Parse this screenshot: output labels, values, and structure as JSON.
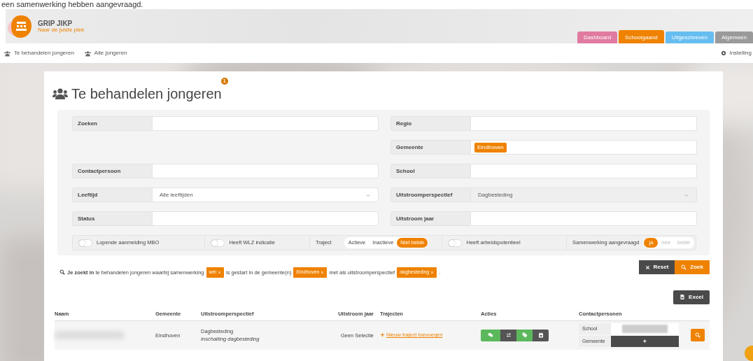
{
  "caption": "een samenwerking hebben aangevraagd.",
  "header": {
    "app_title": "GRIP JIKP",
    "tagline": "Naar de juiste plek",
    "tabs": [
      {
        "label": "Dashboard",
        "color": "#e07aa0",
        "selected": false
      },
      {
        "label": "Schoolgaand",
        "color": "#ef8200",
        "selected": true
      },
      {
        "label": "Uitgeschreven",
        "color": "#66bdf0",
        "selected": false
      },
      {
        "label": "Algemeen",
        "color": "#9a9a9a",
        "selected": false
      }
    ]
  },
  "nav": {
    "items": [
      {
        "label": "Te behandelen jongeren"
      },
      {
        "label": "Alle jongeren"
      }
    ],
    "settings": "Instelling"
  },
  "page": {
    "title": "Te behandelen jongeren",
    "badge": "1"
  },
  "filters": {
    "rows": [
      {
        "left": {
          "label": "Zoeken",
          "kind": "input"
        },
        "right": {
          "label": "Regio",
          "kind": "input"
        }
      },
      {
        "left": null,
        "right": {
          "label": "Gemeente",
          "kind": "tags",
          "tags": [
            "Eindhoven"
          ]
        }
      },
      {
        "left": {
          "label": "Contactpersoon",
          "kind": "input"
        },
        "right": {
          "label": "School",
          "kind": "input"
        }
      },
      {
        "left": {
          "label": "Leeftijd",
          "kind": "select",
          "value": "Alle leeftijden",
          "disabled": false
        },
        "right": {
          "label": "Uitstroomperspectief",
          "kind": "select",
          "value": "Dagbesteding",
          "disabled": true
        }
      },
      {
        "left": {
          "label": "Status",
          "kind": "input"
        },
        "right": {
          "label": "Uitstroom jaar",
          "kind": "input"
        }
      }
    ],
    "toggles": [
      {
        "kind": "switch",
        "label": "Lopende aanmelding MBO",
        "on": false
      },
      {
        "kind": "switch",
        "label": "Heeft WLZ indicatie",
        "on": false
      },
      {
        "kind": "segmented",
        "label": "Traject",
        "options": [
          {
            "label": "Actieve",
            "selected": false
          },
          {
            "label": "Inactieve",
            "selected": false
          },
          {
            "label": "Niet beide",
            "selected": true
          }
        ]
      },
      {
        "kind": "switch",
        "label": "Heeft arbeidspotentieel",
        "on": false
      },
      {
        "kind": "segmented",
        "label": "Samenwerking aangevraagd",
        "options": [
          {
            "label": "ja",
            "selected": true
          },
          {
            "label": "nee",
            "selected": false
          },
          {
            "label": "beide",
            "selected": false
          }
        ]
      }
    ]
  },
  "summary": [
    {
      "kind": "text",
      "text": "**Je zoekt in** te behandelen jongeren waarbij samenwerking"
    },
    {
      "kind": "chip",
      "text": "wel"
    },
    {
      "kind": "text",
      "text": "is gestart in de gemeente(n)"
    },
    {
      "kind": "chip",
      "text": "Eindhoven"
    },
    {
      "kind": "text",
      "text": "met als uitstroomperspectief"
    },
    {
      "kind": "chip",
      "text": "dagbesteding"
    },
    {
      "kind": "text",
      "text": "."
    }
  ],
  "buttons": {
    "reset": "Reset",
    "search": "Zoek",
    "excel": "Excel"
  },
  "table": {
    "columns": [
      "Naam",
      "Gemeente",
      "Uitstroomperspectief",
      "Uitstroom jaar",
      "Trajecten",
      "Acties",
      "Contactpersonen"
    ],
    "rows": [
      {
        "gemeente": "Eindhoven",
        "perspectief": "Dagbesteding",
        "perspectief_note": "Inschatting dagbesteding",
        "jaar": "Geen Selectie",
        "traject_link": "Nieuw traject toevoegen",
        "actions": [
          {
            "kind": "chat",
            "color": "#5cb85c"
          },
          {
            "kind": "swap",
            "color": "#555555"
          },
          {
            "kind": "tag",
            "color": "#5cb85c"
          },
          {
            "kind": "calendar",
            "color": "#555555"
          }
        ],
        "contacts": [
          {
            "role": "School",
            "kind": "blurred"
          },
          {
            "role": "Gemeente",
            "kind": "add",
            "action": "+"
          }
        ]
      }
    ]
  }
}
